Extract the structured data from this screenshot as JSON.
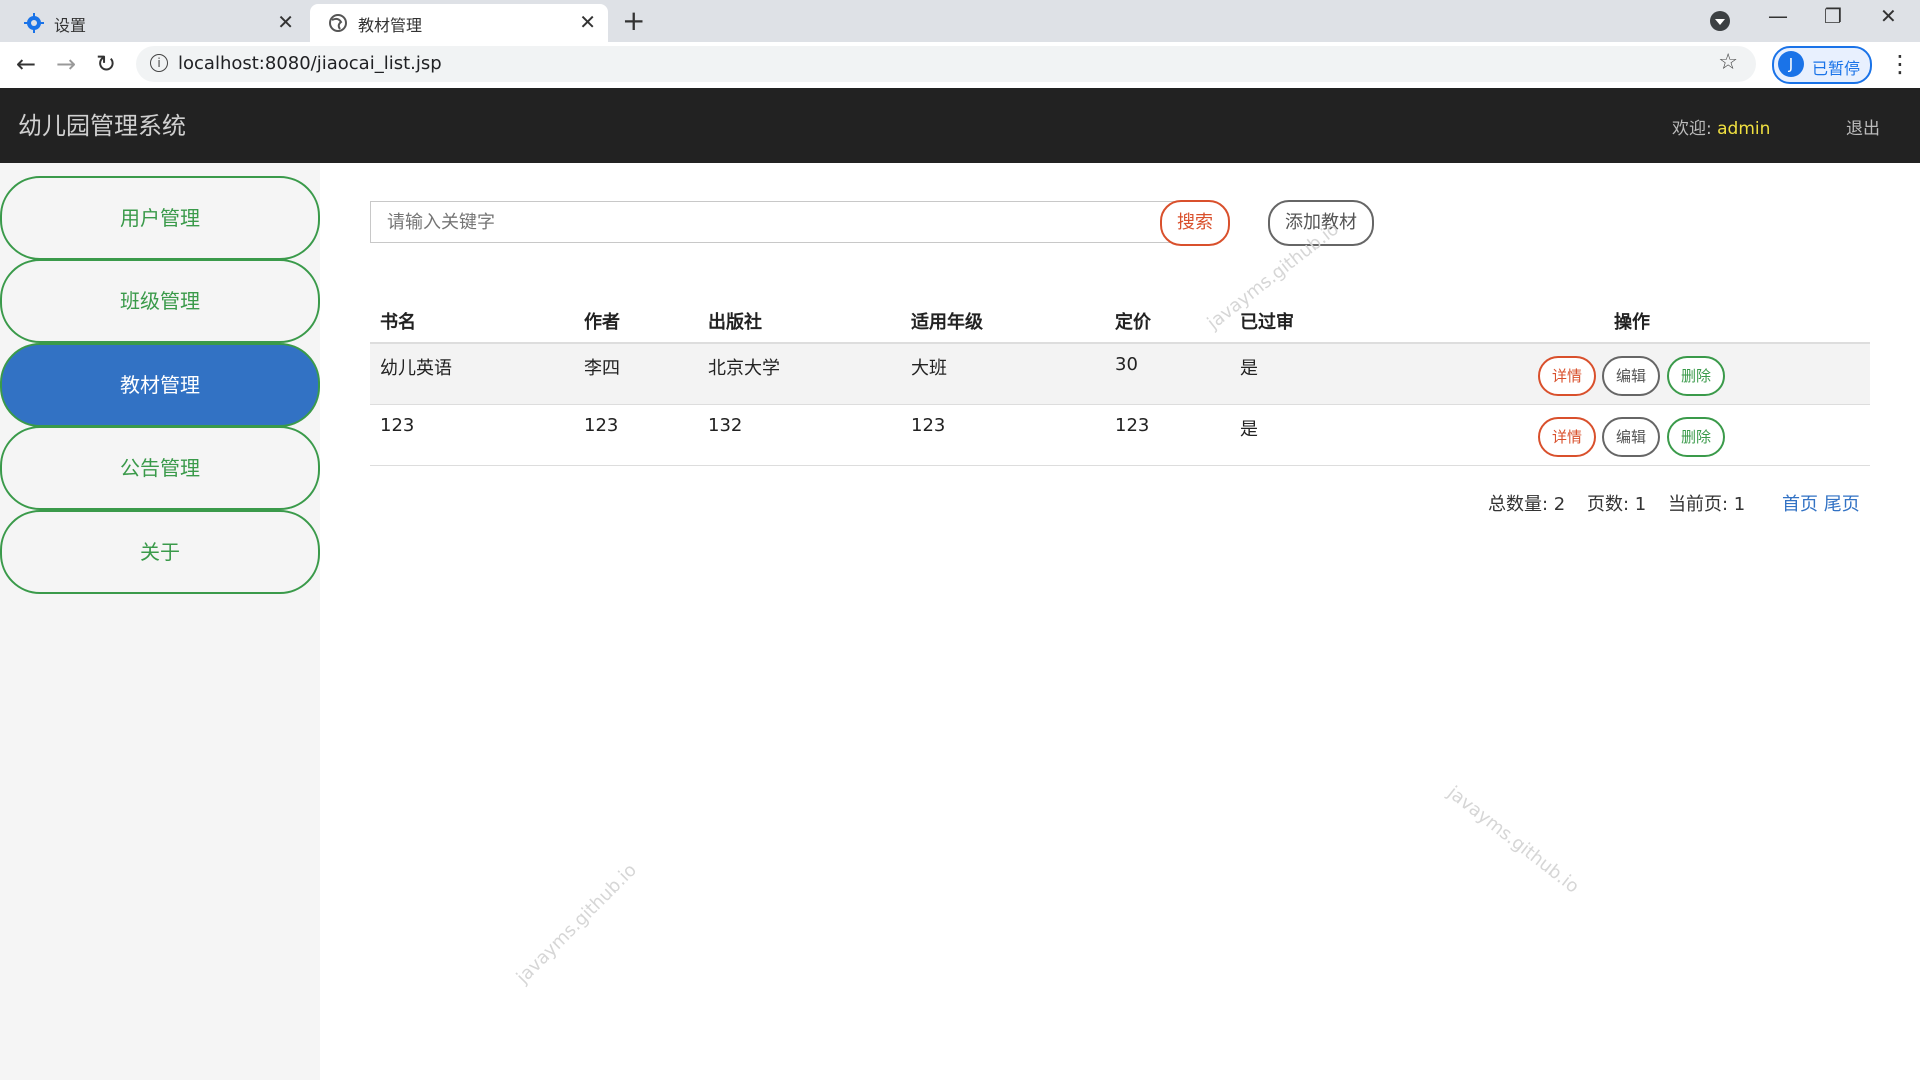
{
  "browser": {
    "tabs": [
      {
        "title": "设置",
        "icon": "gear-icon",
        "active": false
      },
      {
        "title": "教材管理",
        "icon": "globe-icon",
        "active": true
      }
    ],
    "new_tab": "+",
    "url": "localhost:8080/jiaocai_list.jsp",
    "profile_initial": "J",
    "profile_status": "已暂停"
  },
  "app": {
    "title": "幼儿园管理系统",
    "welcome_label": "欢迎:",
    "username": "admin",
    "logout": "退出"
  },
  "sidebar": {
    "items": [
      {
        "label": "用户管理",
        "active": false
      },
      {
        "label": "班级管理",
        "active": false
      },
      {
        "label": "教材管理",
        "active": true
      },
      {
        "label": "公告管理",
        "active": false
      },
      {
        "label": "关于",
        "active": false
      }
    ]
  },
  "search": {
    "placeholder": "请输入关键字",
    "button": "搜索",
    "add_button": "添加教材"
  },
  "table": {
    "headers": [
      "书名",
      "作者",
      "出版社",
      "适用年级",
      "定价",
      "已过审",
      "操作"
    ],
    "rows": [
      [
        "幼儿英语",
        "李四",
        "北京大学",
        "大班",
        "30",
        "是"
      ],
      [
        "123",
        "123",
        "132",
        "123",
        "123",
        "是"
      ]
    ],
    "actions": [
      "详情",
      "编辑",
      "删除"
    ]
  },
  "pagination": {
    "total_label": "总数量: 2",
    "pages_label": "页数: 1",
    "current_label": "当前页: 1",
    "first": "首页",
    "last": "尾页"
  },
  "watermark": "javayms.github.io",
  "colors": {
    "header_bg": "#222222",
    "sidebar_active": "#3272c4",
    "sidebar_border": "#3a9a4a",
    "danger": "#d9502c",
    "username": "#f0e040"
  }
}
